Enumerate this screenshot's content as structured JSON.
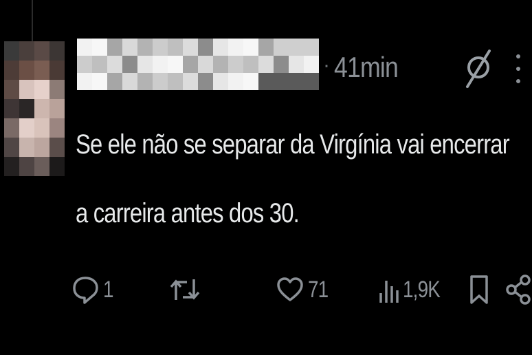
{
  "post": {
    "time": "41min",
    "text_lines": [
      "Se ele não se separar da Virgínia vai encerrar",
      "a carreira antes dos 30."
    ],
    "actions": {
      "reply_count": "1",
      "like_count": "71",
      "views_count": "1,9K"
    },
    "icons": [
      "grok-icon",
      "more-icon",
      "reply-icon",
      "retweet-icon",
      "like-icon",
      "views-icon",
      "bookmark-icon",
      "share-icon"
    ]
  },
  "colors": {
    "background": "#000000",
    "text": "#e7e9ea",
    "muted": "#8b9096"
  }
}
